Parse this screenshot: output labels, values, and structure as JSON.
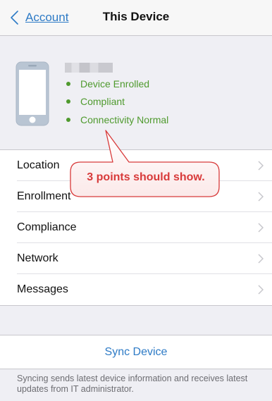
{
  "nav": {
    "back_label": "Account",
    "title": "This Device"
  },
  "device": {
    "name": "iPhone",
    "statuses": [
      "Device Enrolled",
      "Compliant",
      "Connectivity Normal"
    ],
    "status_color": "#4f9a2e"
  },
  "menu": [
    {
      "label": "Location"
    },
    {
      "label": "Enrollment"
    },
    {
      "label": "Compliance"
    },
    {
      "label": "Network"
    },
    {
      "label": "Messages"
    }
  ],
  "sync": {
    "label": "Sync Device",
    "note": "Syncing sends latest device information and receives latest updates from IT administrator."
  },
  "annotation": {
    "text": "3 points should show.",
    "color": "#d83a3a"
  },
  "colors": {
    "accent": "#2e7bc6",
    "background": "#efeff4"
  }
}
